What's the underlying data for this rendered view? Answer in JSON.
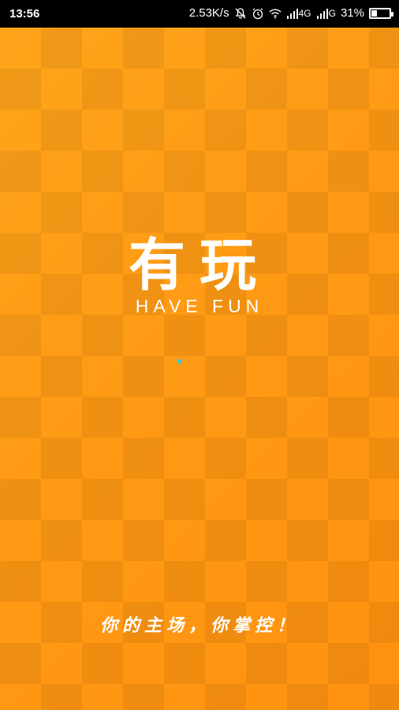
{
  "status_bar": {
    "time": "13:56",
    "speed": "2.53K/s",
    "icons": [
      "mute-bell-icon",
      "alarm-icon",
      "wifi-icon",
      "signal-4g-icon",
      "signal-g-icon"
    ],
    "net1": "4G",
    "net2": "G",
    "battery_percent_text": "31%",
    "battery_level": 0.31
  },
  "splash": {
    "title_cn": "有玩",
    "title_en": "HAVE FUN",
    "slogan": "你的主场，你掌控！"
  },
  "colors": {
    "bg_orange": "#ff9a14",
    "loader_dot": "#38c8d8"
  }
}
